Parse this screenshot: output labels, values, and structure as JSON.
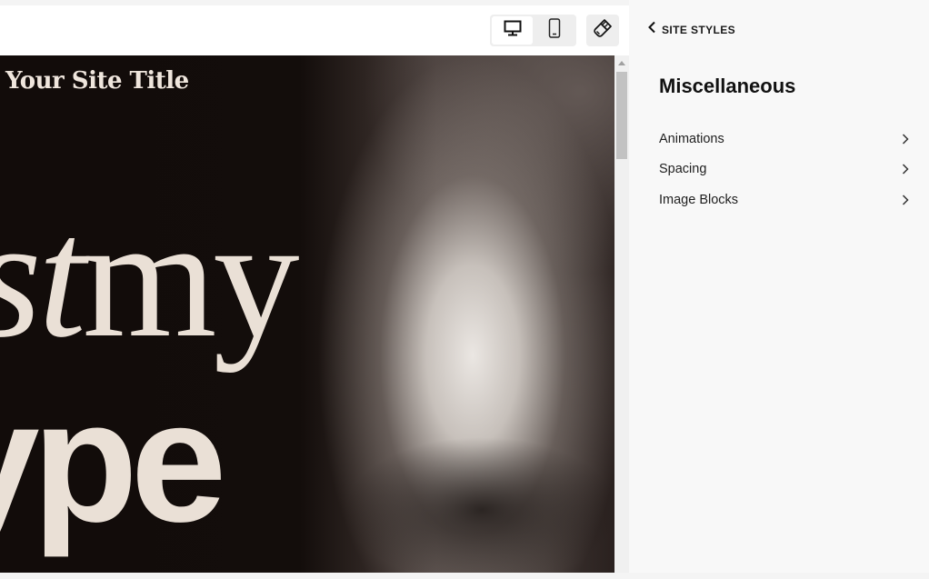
{
  "preview": {
    "site_title": "Your Site Title",
    "hero_line1_italic": "st",
    "hero_line1_regular": "my",
    "hero_line2": "ype",
    "toolbar": {
      "desktop_icon": "desktop-monitor-icon",
      "mobile_icon": "mobile-phone-icon",
      "style_icon": "paintbrush-icon",
      "active_device": "desktop"
    }
  },
  "panel": {
    "back_label": "SITE STYLES",
    "back_icon": "chevron-left-icon",
    "heading": "Miscellaneous",
    "items": [
      {
        "label": "Animations",
        "icon": "chevron-right-icon"
      },
      {
        "label": "Spacing",
        "icon": "chevron-right-icon"
      },
      {
        "label": "Image Blocks",
        "icon": "chevron-right-icon"
      }
    ]
  },
  "colors": {
    "hero_text": "#eae0d6",
    "hero_background": "#120c0a",
    "panel_background": "#f8f8f8",
    "panel_text": "#111111"
  }
}
